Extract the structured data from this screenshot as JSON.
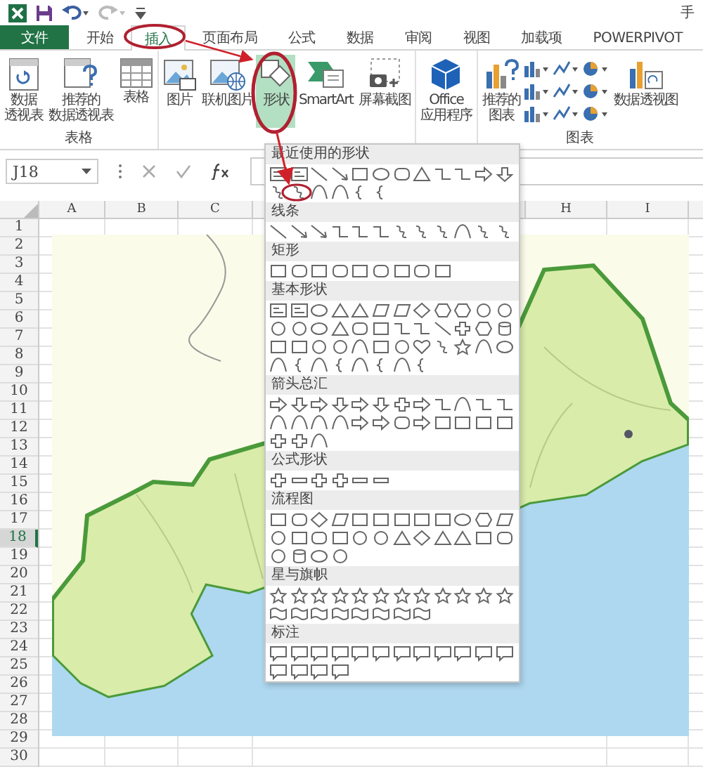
{
  "window": {
    "title": "手"
  },
  "tabs": [
    {
      "label": "文件",
      "kind": "file",
      "selected": false
    },
    {
      "label": "开始",
      "kind": "tab",
      "selected": false
    },
    {
      "label": "插入",
      "kind": "tab",
      "selected": true
    },
    {
      "label": "页面布局",
      "kind": "tab",
      "selected": false
    },
    {
      "label": "公式",
      "kind": "tab",
      "selected": false
    },
    {
      "label": "数据",
      "kind": "tab",
      "selected": false
    },
    {
      "label": "审阅",
      "kind": "tab",
      "selected": false
    },
    {
      "label": "视图",
      "kind": "tab",
      "selected": false
    },
    {
      "label": "加载项",
      "kind": "tab",
      "selected": false
    },
    {
      "label": "POWERPIVOT",
      "kind": "tab",
      "selected": false
    }
  ],
  "ribbon": {
    "groups": [
      {
        "label": "表格",
        "buttons": [
          {
            "lines": [
              "数据",
              "透视表"
            ],
            "kind": "large",
            "pressed": false
          },
          {
            "lines": [
              "推荐的",
              "数据透视表"
            ],
            "kind": "large",
            "pressed": false
          },
          {
            "lines": [
              "表格"
            ],
            "kind": "large",
            "pressed": false
          }
        ]
      },
      {
        "buttons": [
          {
            "lines": [
              "图片"
            ],
            "kind": "large",
            "pressed": false
          },
          {
            "lines": [
              "联机图片"
            ],
            "kind": "large",
            "pressed": false
          },
          {
            "lines": [
              "形状"
            ],
            "kind": "large",
            "pressed": true
          },
          {
            "lines": [
              "SmartArt"
            ],
            "kind": "large",
            "pressed": false
          },
          {
            "lines": [
              "屏幕截图"
            ],
            "kind": "large",
            "pressed": false
          }
        ]
      },
      {
        "buttons": [
          {
            "lines": [
              "Office",
              "应用程序"
            ],
            "kind": "large",
            "pressed": false
          }
        ]
      },
      {
        "label": "图表",
        "buttons": [
          {
            "lines": [
              "推荐的",
              "图表"
            ],
            "kind": "large",
            "pressed": false
          },
          {
            "kind": "chart-grid"
          },
          {
            "lines": [
              "数据透视图"
            ],
            "kind": "large",
            "pressed": false
          }
        ]
      }
    ]
  },
  "formula_bar": {
    "name_box": "J18"
  },
  "sheet": {
    "columns": [
      "A",
      "B",
      "C",
      "H",
      "I"
    ],
    "rows": [
      {
        "label": "1",
        "selected": false
      },
      {
        "label": "2",
        "selected": false
      },
      {
        "label": "3",
        "selected": false
      },
      {
        "label": "4",
        "selected": false
      },
      {
        "label": "5",
        "selected": false
      },
      {
        "label": "6",
        "selected": false
      },
      {
        "label": "7",
        "selected": false
      },
      {
        "label": "8",
        "selected": false
      },
      {
        "label": "9",
        "selected": false
      },
      {
        "label": "10",
        "selected": false
      },
      {
        "label": "11",
        "selected": false
      },
      {
        "label": "12",
        "selected": false
      },
      {
        "label": "13",
        "selected": false
      },
      {
        "label": "14",
        "selected": false
      },
      {
        "label": "15",
        "selected": false
      },
      {
        "label": "16",
        "selected": false
      },
      {
        "label": "17",
        "selected": false
      },
      {
        "label": "18",
        "selected": true
      },
      {
        "label": "19",
        "selected": false
      },
      {
        "label": "20",
        "selected": false
      },
      {
        "label": "21",
        "selected": false
      },
      {
        "label": "22",
        "selected": false
      },
      {
        "label": "23",
        "selected": false
      },
      {
        "label": "24",
        "selected": false
      },
      {
        "label": "25",
        "selected": false
      },
      {
        "label": "26",
        "selected": false
      },
      {
        "label": "27",
        "selected": false
      },
      {
        "label": "28",
        "selected": false
      },
      {
        "label": "29",
        "selected": false
      },
      {
        "label": "30",
        "selected": false
      }
    ]
  },
  "shapes_menu": {
    "sections": [
      {
        "title": "最近使用的形状"
      },
      {
        "title": "线条"
      },
      {
        "title": "矩形"
      },
      {
        "title": "基本形状"
      },
      {
        "title": "箭头总汇"
      },
      {
        "title": "公式形状"
      },
      {
        "title": "流程图"
      },
      {
        "title": "星与旗帜"
      },
      {
        "title": "标注"
      }
    ]
  }
}
